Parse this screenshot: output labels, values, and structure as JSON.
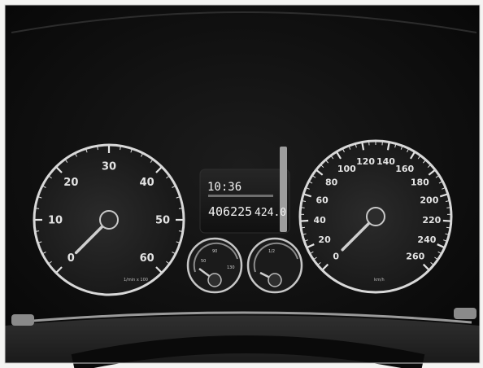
{
  "tachometer": {
    "labels": [
      "0",
      "10",
      "20",
      "30",
      "40",
      "50",
      "60"
    ],
    "caption": "1/min x 100",
    "needle_value": 0
  },
  "speedometer": {
    "labels": [
      "0",
      "20",
      "40",
      "60",
      "80",
      "100",
      "120",
      "140",
      "160",
      "180",
      "200",
      "220",
      "240",
      "260"
    ],
    "caption": "km/h",
    "needle_value": 0
  },
  "display": {
    "clock": "10:36",
    "odometer": "406225",
    "trip": "424.0"
  },
  "coolant_gauge": {
    "labels": [
      "50",
      "90",
      "130"
    ]
  },
  "fuel_gauge": {
    "labels": [
      "1/2"
    ]
  },
  "colors": {
    "dash": "#141414",
    "ring": "#dcdcdc",
    "needle": "#c8c8c8",
    "paper": "#f4f4f2"
  }
}
